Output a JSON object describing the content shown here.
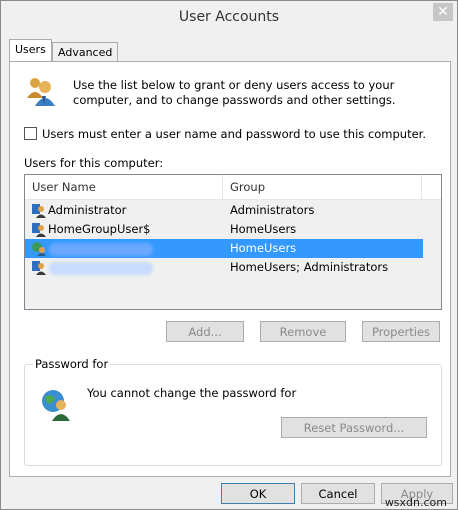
{
  "window": {
    "title": "User Accounts",
    "close_glyph": "✕"
  },
  "tabs": [
    {
      "label": "Users",
      "active": true
    },
    {
      "label": "Advanced",
      "active": false
    }
  ],
  "users_tab": {
    "description": "Use the list below to grant or deny users access to your computer, and to change passwords and other settings.",
    "require_login_checkbox": {
      "label": "Users must enter a user name and password to use this computer.",
      "checked": false
    },
    "list_label": "Users for this computer:",
    "columns": [
      "User Name",
      "Group"
    ],
    "rows": [
      {
        "name": "Administrator",
        "group": "Administrators",
        "selected": false,
        "icon": "admin-user-icon"
      },
      {
        "name": "HomeGroupUser$",
        "group": "HomeUsers",
        "selected": false,
        "icon": "admin-user-icon"
      },
      {
        "name": "",
        "group": "HomeUsers",
        "selected": true,
        "icon": "globe-user-icon"
      },
      {
        "name": "",
        "group": "HomeUsers; Administrators",
        "selected": false,
        "icon": "admin-user-icon"
      }
    ],
    "buttons": {
      "add": "Add...",
      "remove": "Remove",
      "properties": "Properties"
    },
    "password_group": {
      "legend": "Password for",
      "message": "You cannot change the password for",
      "reset_button": "Reset Password..."
    }
  },
  "footer": {
    "ok": "OK",
    "cancel": "Cancel",
    "apply": "Apply"
  },
  "watermark": "wsxdn.com",
  "colors": {
    "selection": "#3399ff",
    "button": "#e1e1e1",
    "border": "#acacac"
  }
}
